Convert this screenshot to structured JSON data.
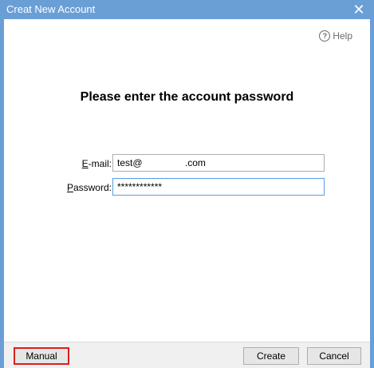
{
  "window": {
    "title": "Creat New Account",
    "close_glyph": "✕"
  },
  "help": {
    "icon": "question-circle-icon",
    "label": "Help"
  },
  "heading": "Please enter the account password",
  "form": {
    "email": {
      "label_accel": "E",
      "label_rest": "-mail:",
      "value": "test@                .com"
    },
    "password": {
      "label_accel": "P",
      "label_rest": "assword:",
      "value": "************"
    }
  },
  "footer": {
    "manual_label": "Manual",
    "create_label": "Create",
    "cancel_label": "Cancel"
  },
  "colors": {
    "titlebar": "#6a9fd6",
    "focus_border": "#569de5",
    "highlight": "#d82020"
  }
}
